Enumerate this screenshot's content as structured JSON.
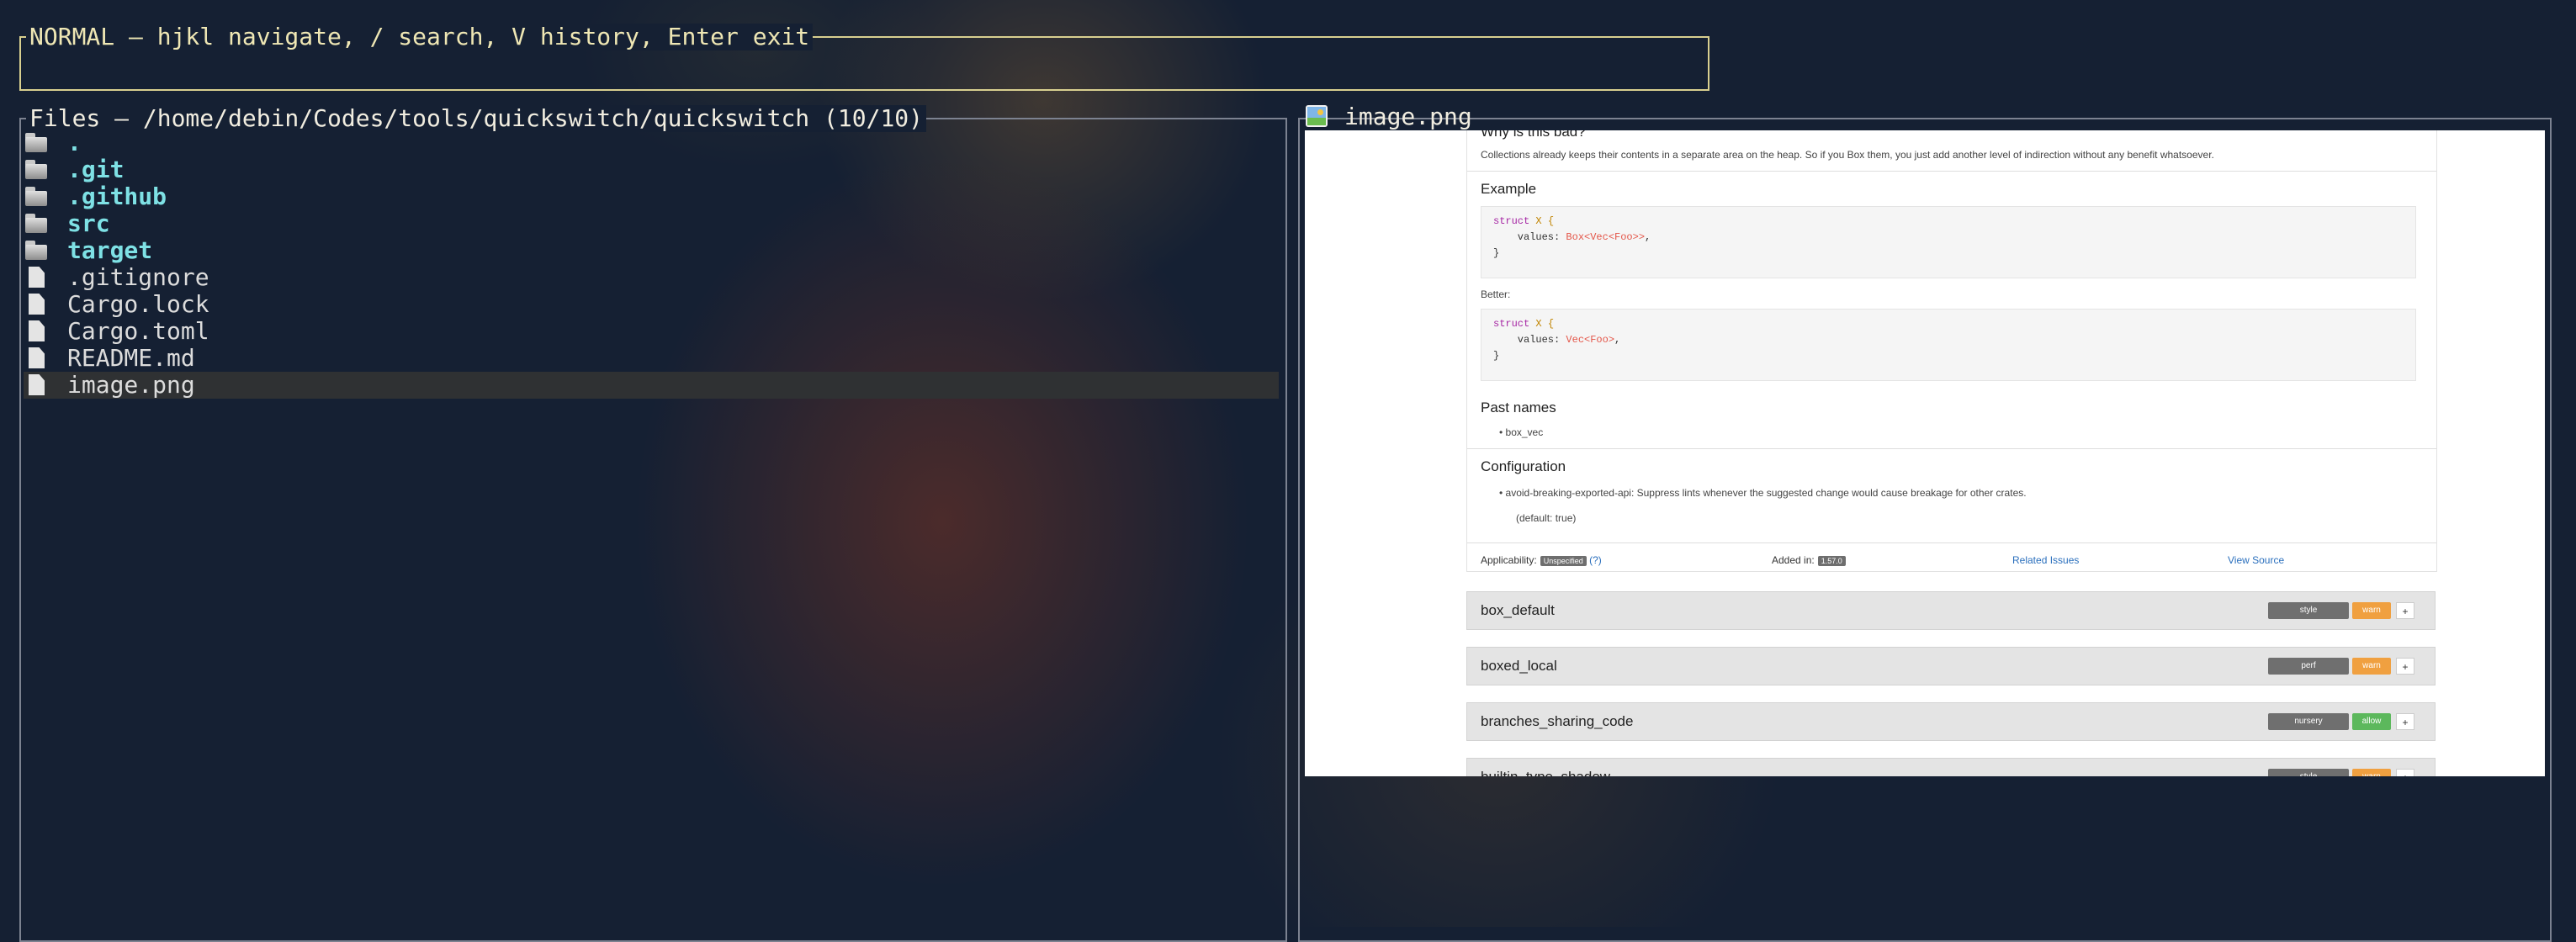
{
  "mode_bar": {
    "text": "NORMAL – hjkl navigate, / search, V history, Enter exit"
  },
  "files_panel": {
    "title": "Files – /home/debin/Codes/tools/quickswitch/quickswitch (10/10)",
    "items": [
      {
        "icon": "folder-icon",
        "name": ".",
        "type": "dir"
      },
      {
        "icon": "folder-icon",
        "name": ".git",
        "type": "dir"
      },
      {
        "icon": "folder-icon",
        "name": ".github",
        "type": "dir"
      },
      {
        "icon": "folder-icon",
        "name": "src",
        "type": "dir"
      },
      {
        "icon": "folder-icon",
        "name": "target",
        "type": "dir"
      },
      {
        "icon": "file-icon",
        "name": ".gitignore",
        "type": "file"
      },
      {
        "icon": "file-icon",
        "name": "Cargo.lock",
        "type": "file"
      },
      {
        "icon": "file-icon",
        "name": "Cargo.toml",
        "type": "file"
      },
      {
        "icon": "file-icon",
        "name": "README.md",
        "type": "file"
      },
      {
        "icon": "file-icon",
        "name": "image.png",
        "type": "file",
        "selected": true
      }
    ]
  },
  "preview_panel": {
    "icon": "image-file-icon",
    "title": "image.png",
    "image_content": {
      "heading_why": "Why is this bad?",
      "why_text": "Collections already keeps their contents in a separate area on the heap. So if you Box them, you just add another level of indirection without any benefit whatsoever.",
      "example_heading": "Example",
      "code_example": {
        "line1_kw": "struct",
        "line1_rest": " X {",
        "line2_field": "    values: ",
        "line2_type": "Box<Vec<Foo>>",
        "line2_end": ",",
        "line3": "}"
      },
      "better_label": "Better:",
      "code_better": {
        "line1_kw": "struct",
        "line1_rest": " X {",
        "line2_field": "    values: ",
        "line2_type": "Vec<Foo>",
        "line2_end": ",",
        "line3": "}"
      },
      "past_names_heading": "Past names",
      "past_name": "• box_vec",
      "config_heading": "Configuration",
      "config_item": "• avoid-breaking-exported-api: Suppress lints whenever the suggested change would cause breakage for other crates.",
      "config_default": "(default: true)",
      "applicability_label": "Applicability:",
      "applicability_value": "Unspecified",
      "applicability_suffix": "(?)",
      "added_in_label": "Added in:",
      "added_in_value": "1.57.0",
      "related_issues": "Related Issues",
      "view_source": "View Source",
      "lints": [
        {
          "name": "box_default",
          "group": "style",
          "level": "warn",
          "level_color": "#f0a040"
        },
        {
          "name": "boxed_local",
          "group": "perf",
          "level": "warn",
          "level_color": "#f0a040"
        },
        {
          "name": "branches_sharing_code",
          "group": "nursery",
          "level": "allow",
          "level_color": "#5cb85c"
        },
        {
          "name": "builtin_type_shadow",
          "group": "style",
          "level": "warn",
          "level_color": "#f0a040"
        }
      ],
      "plus_label": "+"
    }
  },
  "colors": {
    "background": "#152033",
    "mode_border": "#d8cf8f",
    "panel_border": "#7c8290",
    "directory_text": "#7ee1e5",
    "file_text": "#dcdcdc",
    "selected_row": "#2f3133"
  }
}
